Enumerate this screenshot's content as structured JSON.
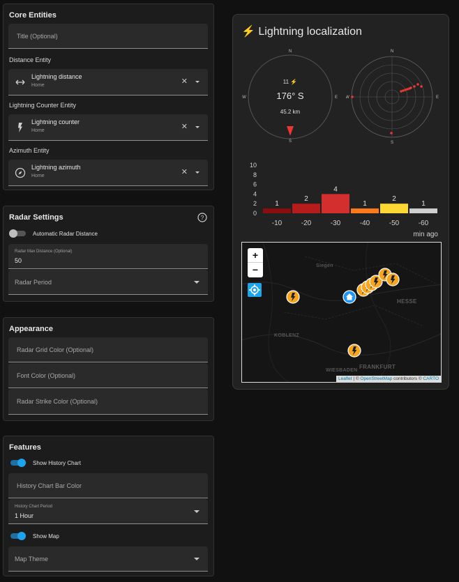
{
  "core": {
    "title": "Core Entities",
    "title_field_placeholder": "Title (Optional)",
    "distance": {
      "label": "Distance Entity",
      "name": "Lightning distance",
      "area": "Home",
      "clear": "✕"
    },
    "counter": {
      "label": "Lightning Counter Entity",
      "name": "Lightning counter",
      "area": "Home",
      "clear": "✕"
    },
    "azimuth": {
      "label": "Azimuth Entity",
      "name": "Lightning azimuth",
      "area": "Home",
      "clear": "✕"
    }
  },
  "radar": {
    "title": "Radar Settings",
    "help_icon": "help-circle-icon",
    "auto_distance_label": "Automatic Radar Distance",
    "auto_distance_on": false,
    "max_distance_label": "Radar Max Distance (Optional)",
    "max_distance_value": "50",
    "period_placeholder": "Radar Period"
  },
  "appearance": {
    "title": "Appearance",
    "grid_color_placeholder": "Radar Grid Color (Optional)",
    "font_color_placeholder": "Font Color (Optional)",
    "strike_color_placeholder": "Radar Strike Color (Optional)"
  },
  "features": {
    "title": "Features",
    "show_history_label": "Show History Chart",
    "show_history_on": true,
    "history_bar_color_placeholder": "History Chart Bar Color",
    "history_period_label": "History Chart Period",
    "history_period_value": "1 Hour",
    "show_map_label": "Show Map",
    "show_map_on": true,
    "map_theme_placeholder": "Map Theme"
  },
  "card": {
    "title_icon": "⚡",
    "title": "Lightning localization",
    "compass": {
      "n": "N",
      "s": "S",
      "e": "E",
      "w": "W",
      "count": "11 ⚡",
      "direction": "176° S",
      "distance": "45.2 km",
      "azimuth_deg": 176
    },
    "radar_plot": {
      "n": "N",
      "s": "S",
      "e": "E",
      "w": "W"
    },
    "map": {
      "zoom_in": "+",
      "zoom_out": "−",
      "labels": [
        "Siegen",
        "HESSE",
        "KOBLENZ",
        "WIESBADEN",
        "FRANKFURT"
      ],
      "attribution_leaflet": "Leaflet",
      "attribution_sep": " | © ",
      "attribution_osm": "OpenStreetMap",
      "attribution_contrib": " contributors © ",
      "attribution_carto": "CARTO"
    }
  },
  "chart_data": {
    "type": "bar",
    "categories": [
      "-10",
      "-20",
      "-30",
      "-40",
      "-50",
      "-60"
    ],
    "values": [
      1,
      2,
      4,
      1,
      2,
      1
    ],
    "colors": [
      "#8b0e0e",
      "#b71c1c",
      "#d32f2f",
      "#ff7a1a",
      "#fdd835",
      "#cfcfcf"
    ],
    "xlabel": "min ago",
    "ylabel": "",
    "ylim": [
      0,
      10
    ],
    "yticks": [
      "0",
      "2",
      "4",
      "6",
      "8",
      "10"
    ]
  }
}
